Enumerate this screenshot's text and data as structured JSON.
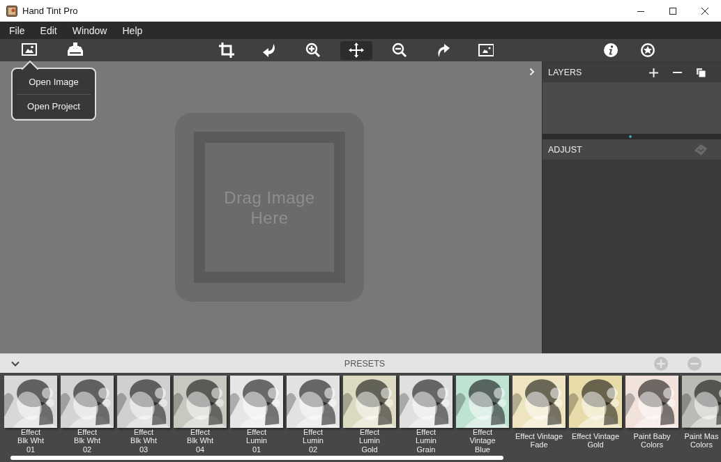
{
  "window": {
    "title": "Hand Tint Pro"
  },
  "menu": [
    "File",
    "Edit",
    "Window",
    "Help"
  ],
  "toolbar": [
    {
      "kind": "open-image",
      "selected": false
    },
    {
      "kind": "save",
      "selected": false
    },
    {
      "kind": "crop",
      "selected": false
    },
    {
      "kind": "rotate-left",
      "selected": false
    },
    {
      "kind": "zoom-in",
      "selected": false
    },
    {
      "kind": "move",
      "selected": true
    },
    {
      "kind": "zoom-out",
      "selected": false
    },
    {
      "kind": "rotate-right",
      "selected": false
    },
    {
      "kind": "fit",
      "selected": false
    },
    {
      "kind": "info",
      "selected": false
    },
    {
      "kind": "settings",
      "selected": false
    }
  ],
  "popup_menu": [
    "Open Image",
    "Open Project"
  ],
  "canvas": {
    "drop_hint": "Drag Image Here"
  },
  "layers": {
    "title": "LAYERS"
  },
  "adjust": {
    "title": "ADJUST"
  },
  "presets": {
    "title": "PRESETS",
    "items": [
      {
        "lines": [
          "Effect",
          "Blk Wht",
          "01"
        ],
        "color": "#d8d8d8"
      },
      {
        "lines": [
          "Effect",
          "Blk Wht",
          "02"
        ],
        "color": "#d4d4d4"
      },
      {
        "lines": [
          "Effect",
          "Blk Wht",
          "03"
        ],
        "color": "#d0d0d0"
      },
      {
        "lines": [
          "Effect",
          "Blk Wht",
          "04"
        ],
        "color": "#c8c8c0"
      },
      {
        "lines": [
          "Effect",
          "Lumin",
          "01"
        ],
        "color": "#e6e6e6"
      },
      {
        "lines": [
          "Effect",
          "Lumin",
          "02"
        ],
        "color": "#e2e2e2"
      },
      {
        "lines": [
          "Effect",
          "Lumin",
          "Gold"
        ],
        "color": "#dcdac0"
      },
      {
        "lines": [
          "Effect",
          "Lumin",
          "Grain"
        ],
        "color": "#e0e0de"
      },
      {
        "lines": [
          "Effect",
          "Vintage",
          "Blue"
        ],
        "color": "#bfe3d3"
      },
      {
        "lines": [
          "Effect Vintage",
          "Fade"
        ],
        "color": "#eee4c0"
      },
      {
        "lines": [
          "Effect Vintage",
          "Gold"
        ],
        "color": "#e8dcaa"
      },
      {
        "lines": [
          "Paint Baby",
          "Colors"
        ],
        "color": "#f2e2dc"
      },
      {
        "lines": [
          "Paint Mas",
          "Colors"
        ],
        "color": "#b8bcb4"
      }
    ]
  }
}
